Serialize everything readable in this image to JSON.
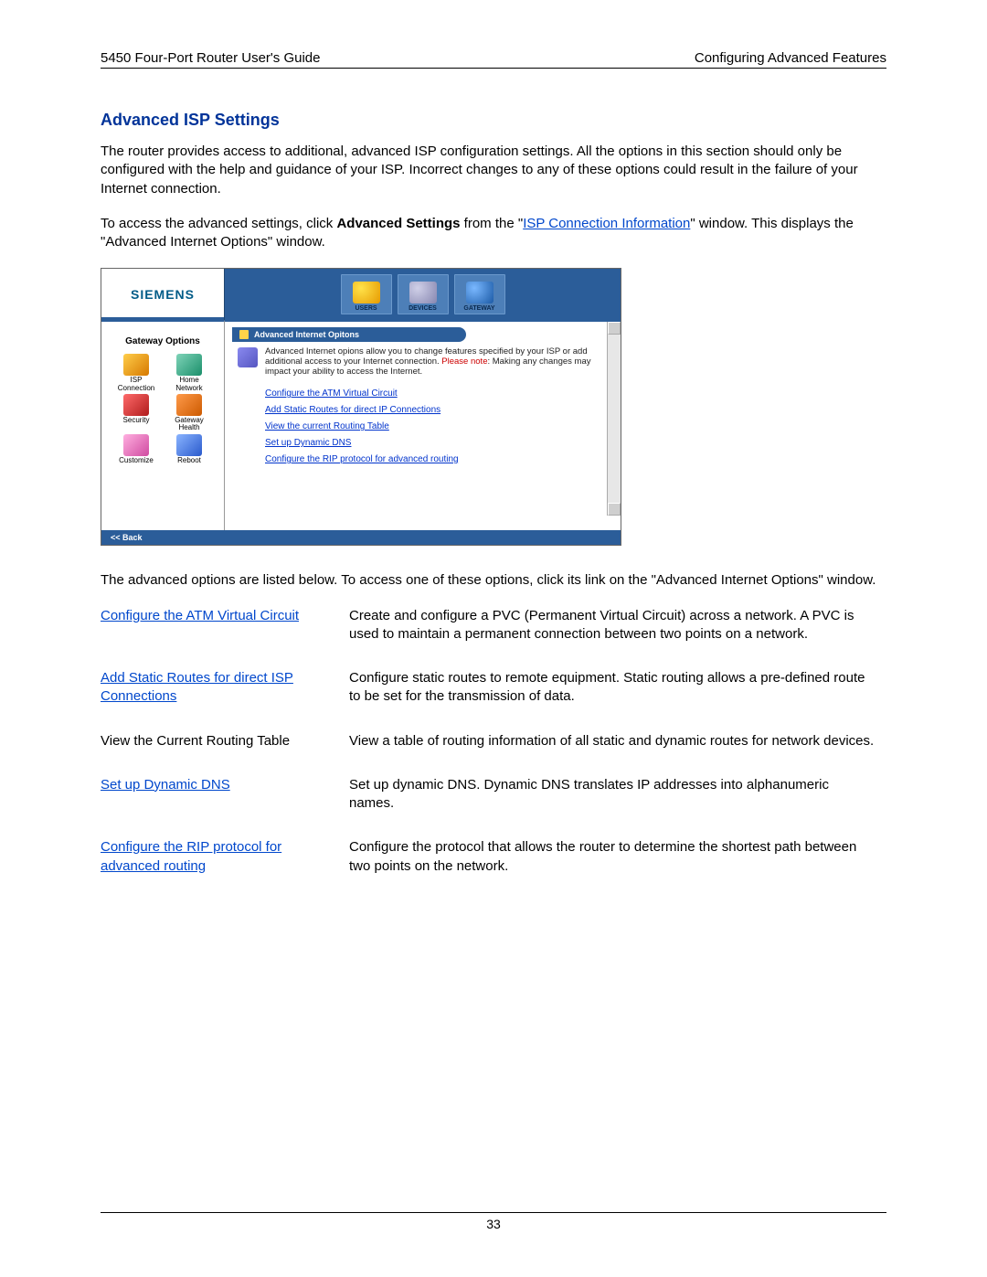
{
  "header": {
    "left": "5450 Four-Port Router User's Guide",
    "right": "Configuring Advanced Features"
  },
  "title": "Advanced ISP Settings",
  "para1": "The router provides access to additional, advanced ISP configuration settings. All the options in this section should only be configured with the help and guidance of your ISP. Incorrect changes to any of these options could result in the failure of your Internet connection.",
  "para2": {
    "pre": "To access the advanced settings, click ",
    "bold": "Advanced Settings",
    "mid": " from the \"",
    "link": "ISP Connection Information",
    "post": "\" window. This displays the \"Advanced Internet Options\" window."
  },
  "screenshot": {
    "brand": "SIEMENS",
    "nav": [
      "USERS",
      "DEVICES",
      "GATEWAY"
    ],
    "sidebar_title": "Gateway Options",
    "sidebar": [
      "ISP Connection",
      "Home Network",
      "Security",
      "Gateway Health",
      "Customize",
      "Reboot"
    ],
    "panel_title": "Advanced Internet Opitons",
    "desc_pre": "Advanced Internet opions allow you to change features specified by your ISP or add additional access to your Internet connection. ",
    "desc_note_label": "Please note",
    "desc_post": ": Making any changes may impact your ability to access the Internet.",
    "links": [
      "Configure the ATM Virtual Circuit",
      "Add Static Routes for direct IP Connections",
      "View the current Routing Table",
      "Set up Dynamic DNS",
      "Configure the RIP protocol for advanced routing"
    ],
    "back": "<< Back"
  },
  "para3": "The advanced options are listed below. To access one of these options, click its link on the \"Advanced Internet Options\" window.",
  "options": [
    {
      "name": "Configure the ATM Virtual Circuit",
      "link": true,
      "desc": "Create and configure a PVC (Permanent Virtual Circuit) across a network. A PVC is used to maintain a permanent connection between two points on a network."
    },
    {
      "name": "Add Static Routes for direct ISP Connections",
      "link": true,
      "desc": "Configure static routes to remote equipment. Static routing allows a pre-defined route to be set for the transmission of data."
    },
    {
      "name": "View the Current Routing Table",
      "link": false,
      "desc": "View a table of routing information of all static and dynamic routes for network devices."
    },
    {
      "name": "Set up Dynamic DNS",
      "link": true,
      "desc": "Set up dynamic DNS. Dynamic DNS translates IP addresses into alphanumeric names."
    },
    {
      "name": "Configure the RIP protocol for advanced routing",
      "link": true,
      "desc": "Configure the protocol that allows the router to determine the shortest path between two points on the network."
    }
  ],
  "page_number": "33"
}
